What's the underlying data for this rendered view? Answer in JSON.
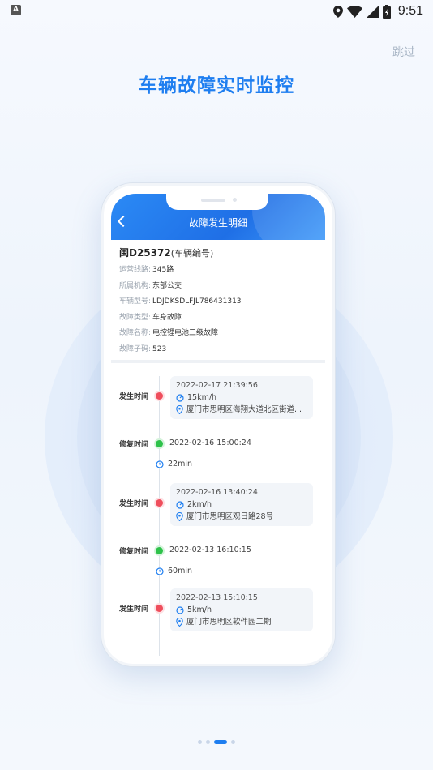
{
  "status_bar": {
    "badge": "A",
    "time": "9:51"
  },
  "skip_label": "跳过",
  "headline": "车辆故障实时监控",
  "app": {
    "title": "故障发生明细",
    "plate": "闽D25372",
    "plate_suffix": "(车辆编号)",
    "fields": [
      {
        "key": "运营线路:",
        "value": "345路"
      },
      {
        "key": "所属机构:",
        "value": "东部公交"
      },
      {
        "key": "车辆型号:",
        "value": "LDJDKSDLFJL786431313"
      },
      {
        "key": "故障类型:",
        "value": "车身故障"
      },
      {
        "key": "故障名称:",
        "value": "电控锂电池三级故障"
      },
      {
        "key": "故障子码:",
        "value": "523"
      }
    ],
    "events": [
      {
        "label": "发生时间",
        "time": "2022-02-17 21:39:56",
        "speed": "15km/h",
        "location": "厦门市思明区海翔大道北区街道..."
      },
      {
        "label": "修复时间",
        "time": "2022-02-16 15:00:24",
        "duration": "22min"
      },
      {
        "label": "发生时间",
        "time": "2022-02-16 13:40:24",
        "speed": "2km/h",
        "location": "厦门市思明区观日路28号"
      },
      {
        "label": "修复时间",
        "time": "2022-02-13 16:10:15",
        "duration": "60min"
      },
      {
        "label": "发生时间",
        "time": "2022-02-13 15:10:15",
        "speed": "5km/h",
        "location": "厦门市思明区软件园二期"
      }
    ]
  },
  "pagination": {
    "count": 4,
    "active": 2
  },
  "colors": {
    "accent": "#1e7ef0",
    "fault_dot": "#ef4e5c",
    "repair_dot": "#2ec24a"
  }
}
